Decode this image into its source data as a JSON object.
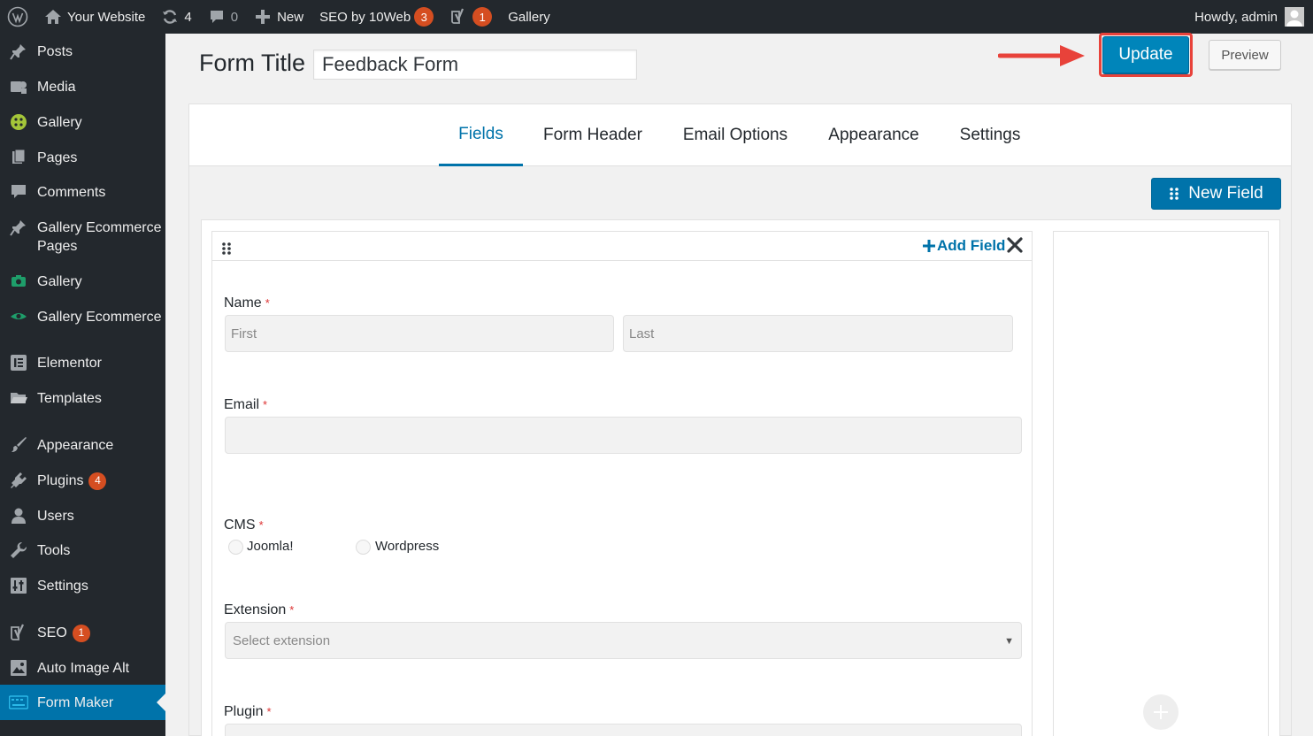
{
  "adminbar": {
    "site_name": "Your Website",
    "updates_count": "4",
    "comments_count": "0",
    "new_label": "New",
    "seo_label": "SEO by 10Web",
    "seo_badge": "3",
    "yoast_badge": "1",
    "gallery_label": "Gallery",
    "howdy": "Howdy, admin"
  },
  "sidebar": {
    "items": [
      {
        "label": "Posts",
        "icon": "pin-icon"
      },
      {
        "label": "Media",
        "icon": "media-icon"
      },
      {
        "label": "Gallery",
        "icon": "gallery-plugin-icon"
      },
      {
        "label": "Pages",
        "icon": "pages-icon"
      },
      {
        "label": "Comments",
        "icon": "comment-icon"
      },
      {
        "label": "Gallery Ecommerce Pages",
        "icon": "pin-icon"
      },
      {
        "label": "Gallery",
        "icon": "camera-icon"
      },
      {
        "label": "Gallery Ecommerce",
        "icon": "eye-icon"
      },
      {
        "label": "Elementor",
        "icon": "elementor-icon"
      },
      {
        "label": "Templates",
        "icon": "folder-icon"
      },
      {
        "label": "Appearance",
        "icon": "brush-icon"
      },
      {
        "label": "Plugins",
        "icon": "plugin-icon",
        "badge": "4"
      },
      {
        "label": "Users",
        "icon": "user-icon"
      },
      {
        "label": "Tools",
        "icon": "wrench-icon"
      },
      {
        "label": "Settings",
        "icon": "settings-icon"
      },
      {
        "label": "SEO",
        "icon": "yoast-icon",
        "badge": "1"
      },
      {
        "label": "Auto Image Alt",
        "icon": "image-alt-icon"
      },
      {
        "label": "Form Maker",
        "icon": "keyboard-icon",
        "active": true
      }
    ]
  },
  "header": {
    "form_title_label": "Form Title",
    "form_title_value": "Feedback Form",
    "update_label": "Update",
    "preview_label": "Preview"
  },
  "tabs": [
    {
      "label": "Fields",
      "active": true
    },
    {
      "label": "Form Header"
    },
    {
      "label": "Email Options"
    },
    {
      "label": "Appearance"
    },
    {
      "label": "Settings"
    }
  ],
  "toolbar": {
    "new_field_label": "New Field",
    "add_field_label": "Add Field"
  },
  "fields": {
    "name": {
      "label": "Name",
      "required": "*",
      "first_placeholder": "First",
      "last_placeholder": "Last"
    },
    "email": {
      "label": "Email",
      "required": "*"
    },
    "cms": {
      "label": "CMS",
      "required": "*",
      "options": [
        "Joomla!",
        "Wordpress"
      ]
    },
    "extension": {
      "label": "Extension",
      "required": "*",
      "placeholder": "Select extension"
    },
    "plugin": {
      "label": "Plugin",
      "required": "*"
    }
  },
  "colors": {
    "accent": "#0073aa",
    "update_button": "#0085ba",
    "annotation_red": "#e8423a",
    "badge": "#d54e21",
    "adminbar_bg": "#23282d"
  }
}
